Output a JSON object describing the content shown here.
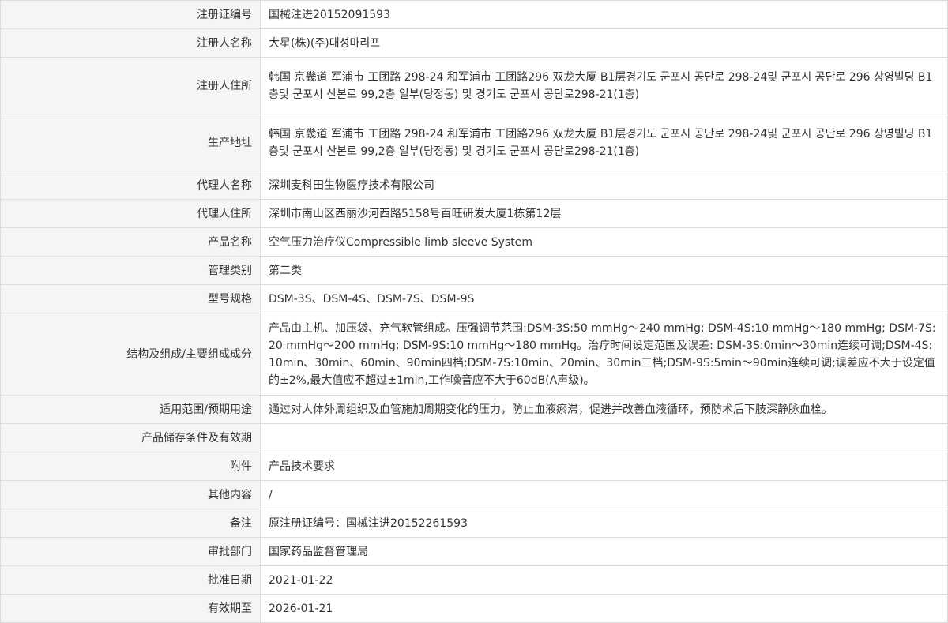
{
  "rows": [
    {
      "label": "注册证编号",
      "value": "国械注进20152091593"
    },
    {
      "label": "注册人名称",
      "value": "大星(株)(주)대성마리프"
    },
    {
      "label": "注册人住所",
      "value": "韩国 京畿道 军浦市 工团路 298-24 和军浦市 工团路296 双龙大厦 B1层경기도 군포시 공단로 298-24및 군포시 공단로 296 상영빌딩 B1층및 군포시 산본로 99,2층 일부(당정동) 및 경기도 군포시 공단로298-21(1층)"
    },
    {
      "label": "生产地址",
      "value": "韩国 京畿道 军浦市 工团路 298-24 和军浦市 工团路296 双龙大厦 B1层경기도 군포시 공단로 298-24및 군포시 공단로 296 상영빌딩 B1층및 군포시 산본로 99,2층 일부(당정동) 및 경기도 군포시 공단로298-21(1층)"
    },
    {
      "label": "代理人名称",
      "value": "深圳麦科田生物医疗技术有限公司"
    },
    {
      "label": "代理人住所",
      "value": "深圳市南山区西丽沙河西路5158号百旺研发大厦1栋第12层"
    },
    {
      "label": "产品名称",
      "value": "空气压力治疗仪Compressible limb sleeve System"
    },
    {
      "label": "管理类别",
      "value": "第二类"
    },
    {
      "label": "型号规格",
      "value": "DSM-3S、DSM-4S、DSM-7S、DSM-9S"
    },
    {
      "label": "结构及组成/主要组成成分",
      "value": "产品由主机、加压袋、充气软管组成。压强调节范围:DSM-3S:50 mmHg～240 mmHg; DSM-4S:10 mmHg～180 mmHg; DSM-7S:20 mmHg～200 mmHg; DSM-9S:10 mmHg～180 mmHg。治疗时间设定范围及误差: DSM-3S:0min～30min连续可调;DSM-4S:10min、30min、60min、90min四档;DSM-7S:10min、20min、30min三档;DSM-9S:5min～90min连续可调;误差应不大于设定值的±2%,最大值应不超过±1min,工作噪音应不大于60dB(A声级)。"
    },
    {
      "label": "适用范围/预期用途",
      "value": "通过对人体外周组织及血管施加周期变化的压力，防止血液瘀滞，促进并改善血液循环，预防术后下肢深静脉血栓。"
    },
    {
      "label": "产品储存条件及有效期",
      "value": ""
    },
    {
      "label": "附件",
      "value": "产品技术要求"
    },
    {
      "label": "其他内容",
      "value": "/"
    },
    {
      "label": "备注",
      "value": "原注册证编号：国械注进20152261593"
    },
    {
      "label": "审批部门",
      "value": "国家药品监督管理局"
    },
    {
      "label": "批准日期",
      "value": "2021-01-22"
    },
    {
      "label": "有效期至",
      "value": "2026-01-21"
    }
  ]
}
